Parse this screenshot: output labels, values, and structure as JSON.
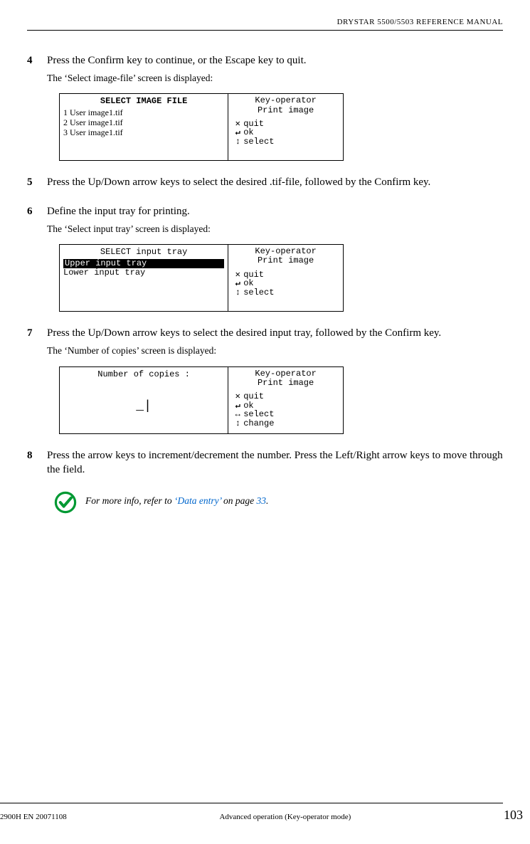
{
  "header": {
    "manual_title": "DRYSTAR 5500/5503 REFERENCE MANUAL"
  },
  "steps": [
    {
      "num": "4",
      "text": "Press the Confirm key to continue, or the Escape key to quit.",
      "subtext": "The ‘Select image-file’ screen is displayed:"
    },
    {
      "num": "5",
      "text": "Press the Up/Down arrow keys to select the desired .tif-file, followed by the Confirm key."
    },
    {
      "num": "6",
      "text": "Define the input tray for printing.",
      "subtext": "The ‘Select input tray’ screen is displayed:"
    },
    {
      "num": "7",
      "text": "Press the Up/Down arrow keys to select the desired input tray, followed by the Confirm key.",
      "subtext": "The ‘Number of copies’ screen is displayed:"
    },
    {
      "num": "8",
      "text": "Press the arrow keys to increment/decrement the number. Press the Left/Right arrow keys to move through the field."
    }
  ],
  "screens": {
    "image_file": {
      "title": "SELECT IMAGE FILE",
      "items": [
        "1 User image1.tif",
        "2 User image1.tif",
        "3 User image1.tif"
      ],
      "right_title_1": "Key-operator",
      "right_title_2": "Print image",
      "actions": [
        {
          "sym": "✕",
          "label": "quit"
        },
        {
          "sym": "↵",
          "label": "ok"
        },
        {
          "sym": "↕",
          "label": "select"
        }
      ]
    },
    "input_tray": {
      "title": "SELECT input tray",
      "item_selected": "Upper input tray",
      "item_other": "Lower input tray",
      "right_title_1": "Key-operator",
      "right_title_2": "Print image",
      "actions": [
        {
          "sym": "✕",
          "label": "quit"
        },
        {
          "sym": "↵",
          "label": "ok"
        },
        {
          "sym": "↕",
          "label": "select"
        }
      ]
    },
    "copies": {
      "title": "Number of copies :",
      "cursor": "_|",
      "right_title_1": "Key-operator",
      "right_title_2": "Print image",
      "actions": [
        {
          "sym": "✕",
          "label": "quit"
        },
        {
          "sym": "↵",
          "label": "ok"
        },
        {
          "sym": "↔",
          "label": "select"
        },
        {
          "sym": "↕",
          "label": "change"
        }
      ]
    }
  },
  "note": {
    "prefix": "For more info, refer to ",
    "link": "‘Data entry’",
    "mid": " on page ",
    "page_ref": "33",
    "suffix": "."
  },
  "footer": {
    "doc_id": "2900H EN 20071108",
    "section": "Advanced operation (Key-operator mode)",
    "page": "103"
  }
}
